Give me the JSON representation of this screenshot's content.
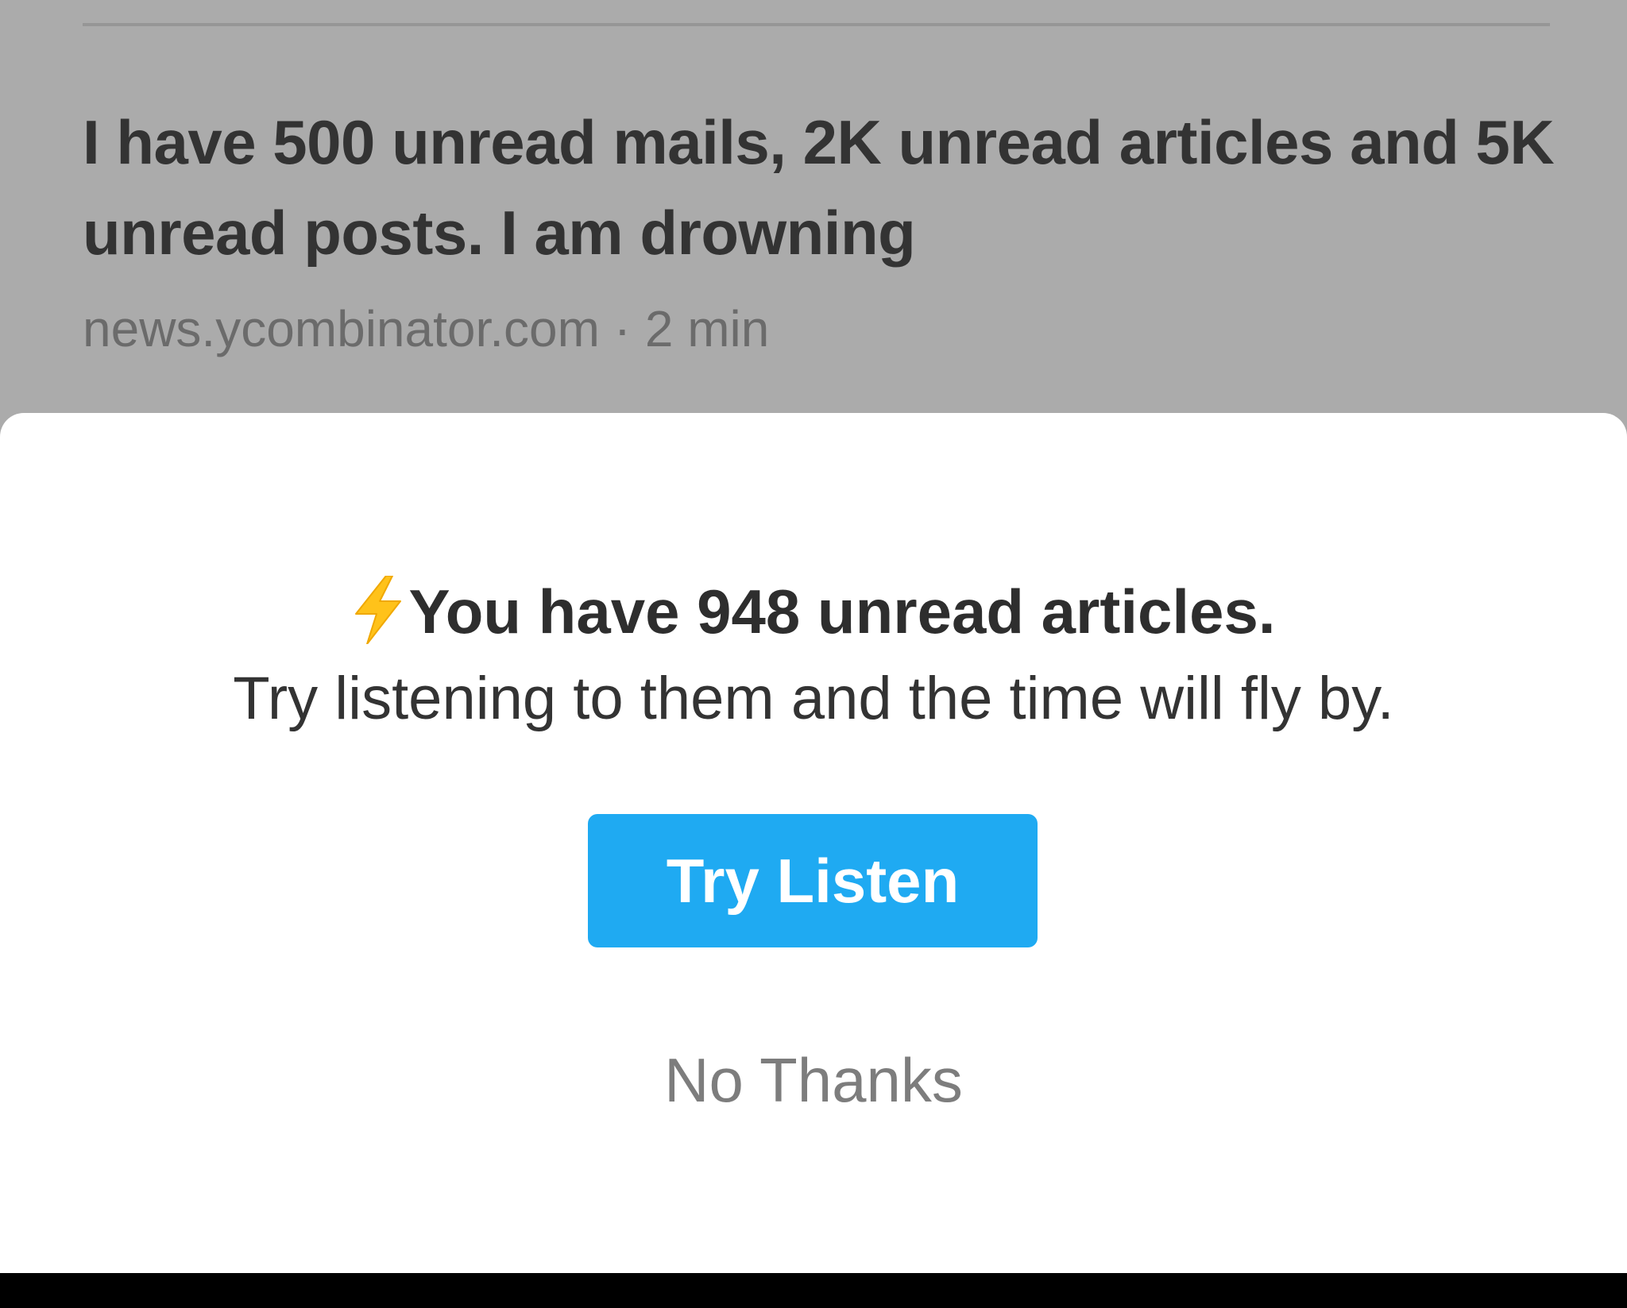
{
  "article": {
    "title": "I have 500 unread mails, 2K unread articles and 5K unread posts. I am drowning",
    "source": "news.ycombinator.com",
    "separator": "·",
    "read_time": "2 min"
  },
  "prompt": {
    "icon": "lightning-bolt-icon",
    "headline": "You have 948 unread articles.",
    "subline": "Try listening to them and the time will fly by.",
    "primary_button": "Try Listen",
    "secondary_button": "No Thanks"
  },
  "colors": {
    "overlay": "#ababab",
    "sheet": "#ffffff",
    "primary_button": "#1faaf2",
    "bolt": "#ffc21a"
  }
}
